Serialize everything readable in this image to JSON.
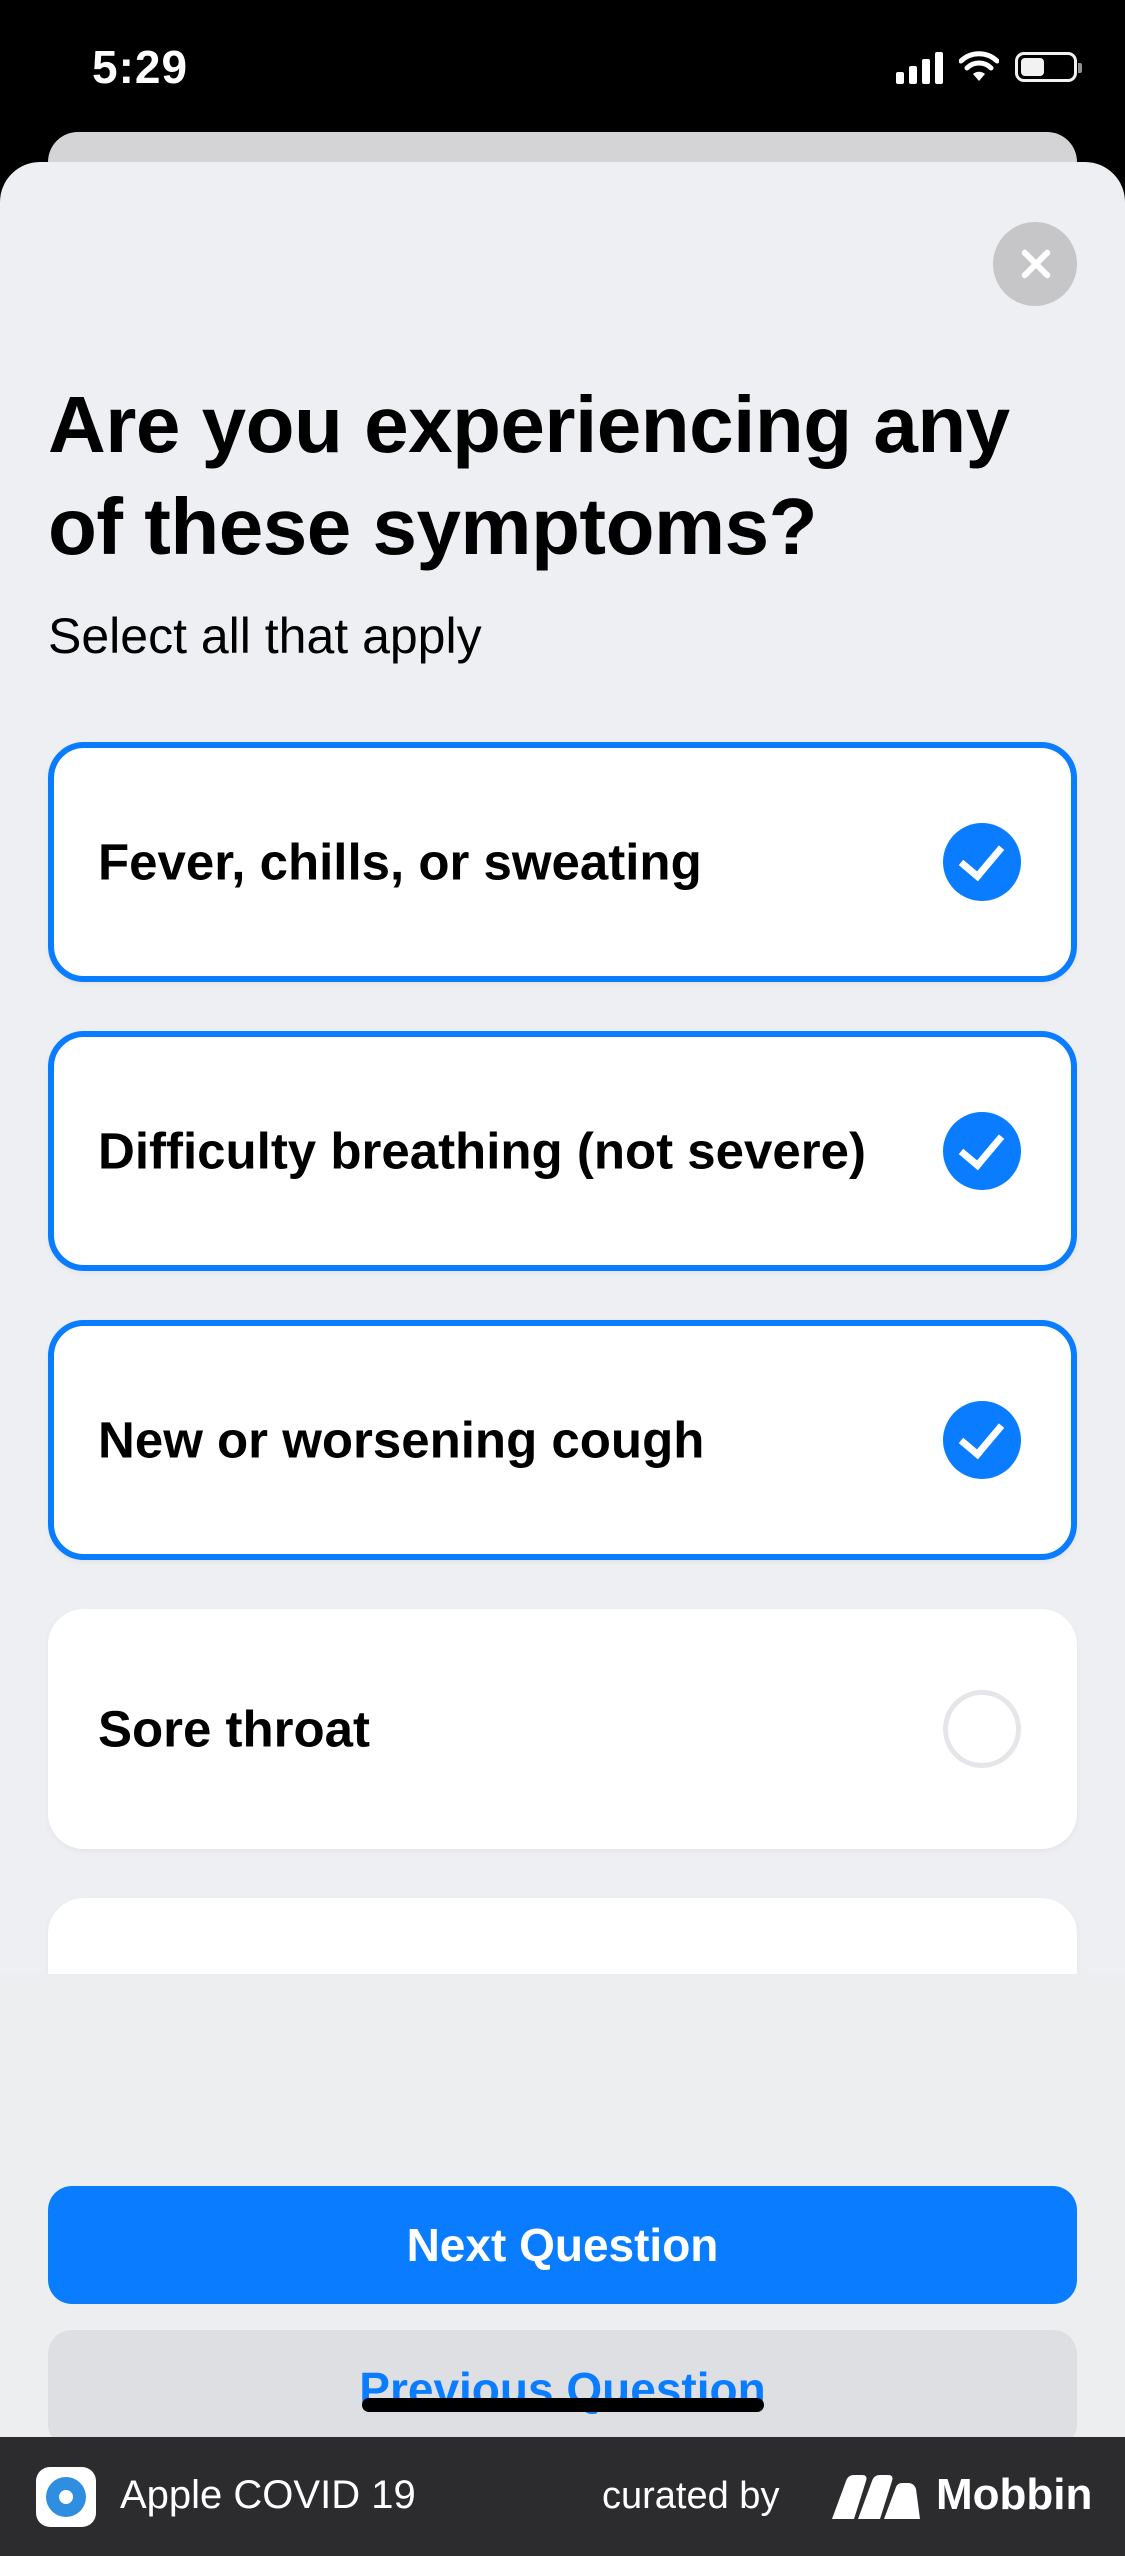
{
  "status_bar": {
    "time": "5:29",
    "battery_level": 0.45
  },
  "question": {
    "title": "Are you experiencing any of these symptoms?",
    "subtitle": "Select all that apply"
  },
  "options": [
    {
      "label": "Fever, chills, or sweating",
      "selected": true
    },
    {
      "label": "Difficulty breathing (not severe)",
      "selected": true
    },
    {
      "label": "New or worsening cough",
      "selected": true
    },
    {
      "label": "Sore throat",
      "selected": false
    }
  ],
  "buttons": {
    "next": "Next Question",
    "previous": "Previous Question"
  },
  "banner": {
    "app_name": "Apple COVID 19",
    "curated_by": "curated by",
    "brand": "Mobbin"
  },
  "colors": {
    "accent": "#0a7cff",
    "sheet_bg": "#eeeff2",
    "banner_bg": "#2c2c2e"
  }
}
